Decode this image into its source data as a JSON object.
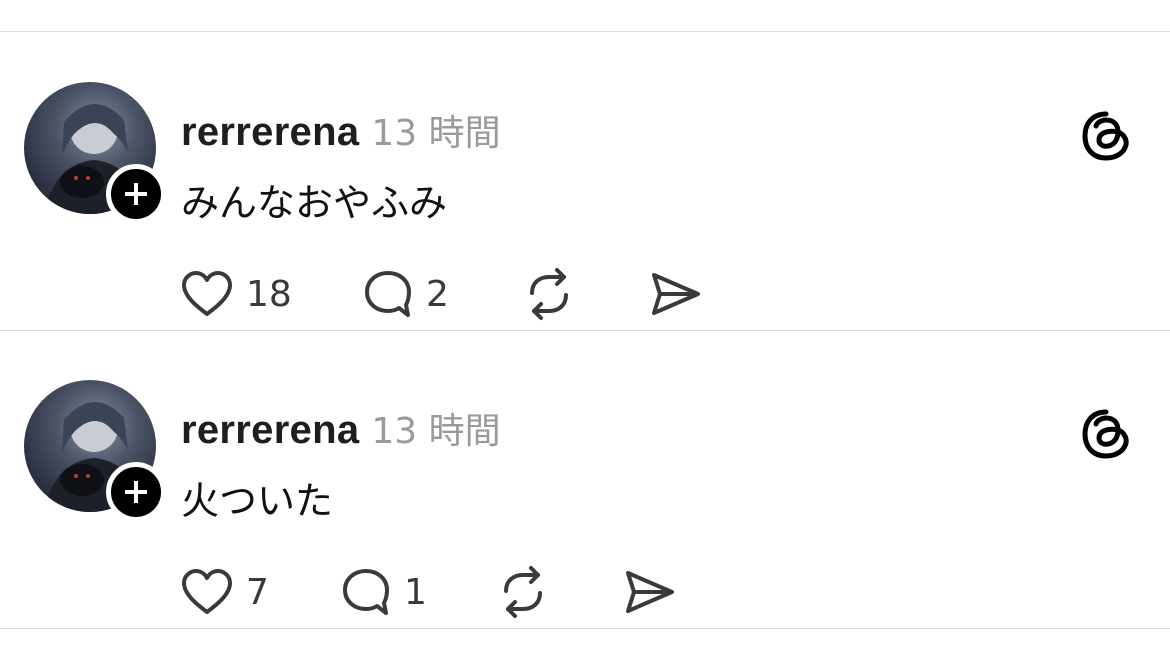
{
  "feed": {
    "posts": [
      {
        "username": "rerrerena",
        "time": "13 時間",
        "text": "みんなおやふみ",
        "likes": "18",
        "replies": "2"
      },
      {
        "username": "rerrerena",
        "time": "13 時間",
        "text": "火ついた",
        "likes": "7",
        "replies": "1"
      }
    ]
  },
  "icons": {
    "like": "heart-icon",
    "reply": "comment-bubble-icon",
    "repost": "repost-icon",
    "share": "send-icon",
    "logo": "threads-logo-icon",
    "follow": "plus-icon"
  },
  "colors": {
    "username": "#1e1e1e",
    "timestamp": "#9a9a9a",
    "divider": "#dcdcdc",
    "icon": "#3a3a3a"
  }
}
